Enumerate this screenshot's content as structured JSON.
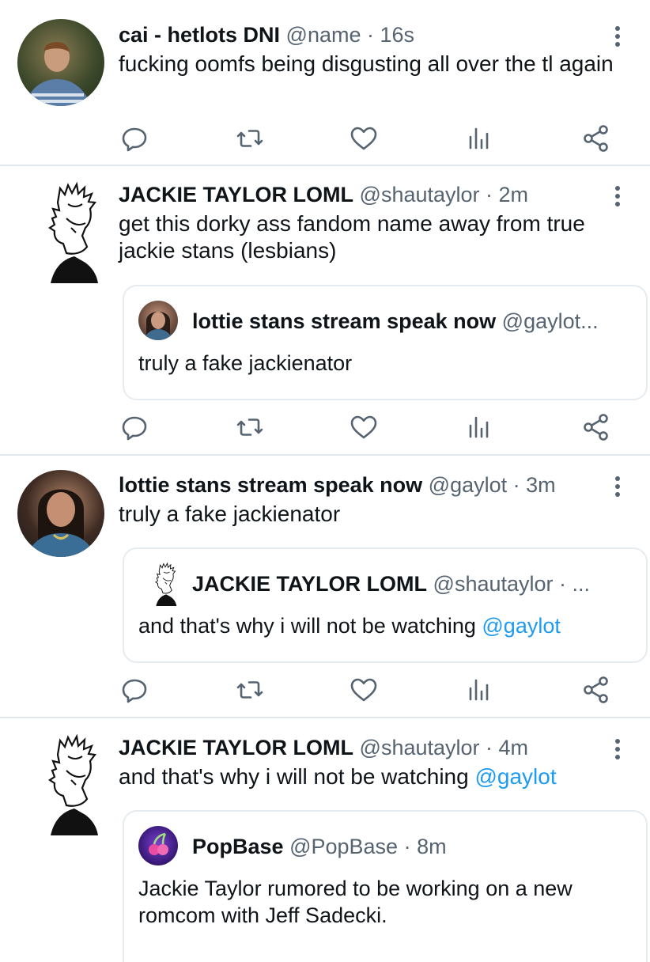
{
  "tweets": [
    {
      "name": "cai - hetlots DNI",
      "handle": "@name",
      "time": "· 16s",
      "text": "fucking oomfs being disgusting all over the tl again"
    },
    {
      "name": "JACKIE TAYLOR LOML",
      "handle": "@shautaylor",
      "time": "· 2m",
      "text": "get this dorky ass fandom name away from true jackie stans (lesbians)",
      "quote": {
        "name": "lottie stans stream speak now",
        "handle": "@gaylot...",
        "text": "truly a fake jackienator"
      }
    },
    {
      "name": "lottie stans stream speak now",
      "handle": "@gaylot",
      "time": "· 3m",
      "text": "truly a fake jackienator",
      "quote": {
        "name": "JACKIE TAYLOR LOML",
        "handle": "@shautaylor · ...",
        "text_prefix": "and that's why i will not be watching ",
        "mention": "@gaylot"
      }
    },
    {
      "name": "JACKIE TAYLOR LOML",
      "handle": "@shautaylor",
      "time": "· 4m",
      "text_prefix": "and that's why i will not be watching ",
      "mention": "@gaylot",
      "quote": {
        "name": "PopBase",
        "handle": "@PopBase",
        "time": "· 8m",
        "text": "Jackie Taylor rumored to be working on a new romcom with Jeff Sadecki."
      }
    }
  ],
  "icons": [
    "reply-icon",
    "retweet-icon",
    "like-icon",
    "analytics-icon",
    "share-icon"
  ],
  "colors": {
    "accent": "#1d9bf0",
    "secondary_text": "#566370",
    "divider": "#e1e6ea"
  }
}
